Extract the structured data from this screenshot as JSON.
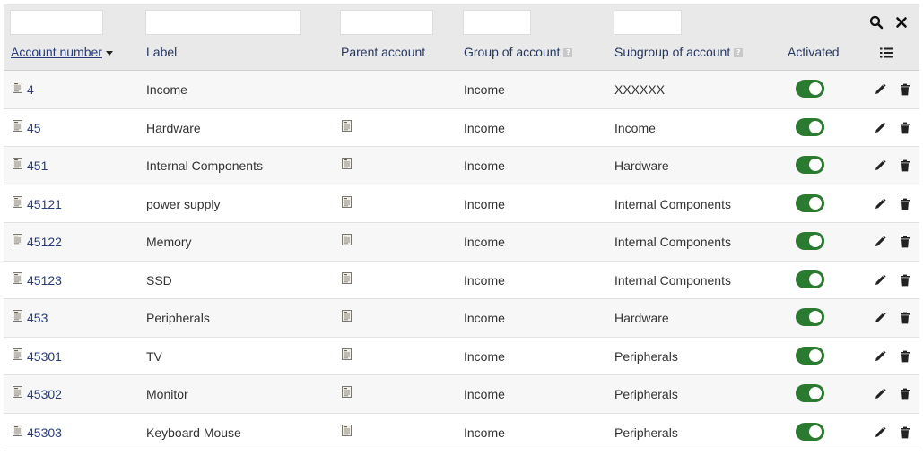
{
  "filters": [
    {
      "col": "account_number",
      "value": ""
    },
    {
      "col": "label",
      "value": ""
    },
    {
      "col": "parent_account",
      "value": ""
    },
    {
      "col": "group_of_account",
      "value": ""
    },
    {
      "col": "subgroup_of_account",
      "value": ""
    }
  ],
  "columns": {
    "account_number": "Account number",
    "label": "Label",
    "parent_account": "Parent account",
    "group_of_account": "Group of account",
    "subgroup_of_account": "Subgroup of account",
    "activated": "Activated"
  },
  "help_glyph": "?",
  "icons": {
    "search": "search-icon",
    "clear": "close-icon",
    "column_selector": "list-icon",
    "edit": "pencil-icon",
    "delete": "trash-icon",
    "account": "document-icon"
  },
  "colors": {
    "header_bg": "#e9e9e9",
    "link": "#263c7c",
    "toggle_on": "#2a7a2f"
  },
  "rows": [
    {
      "account": "4",
      "label": "Income",
      "has_parent": false,
      "group": "Income",
      "subgroup": "XXXXXX",
      "activated": true
    },
    {
      "account": "45",
      "label": "Hardware",
      "has_parent": true,
      "group": "Income",
      "subgroup": "Income",
      "activated": true
    },
    {
      "account": "451",
      "label": "Internal Components",
      "has_parent": true,
      "group": "Income",
      "subgroup": "Hardware",
      "activated": true
    },
    {
      "account": "45121",
      "label": "power supply",
      "has_parent": true,
      "group": "Income",
      "subgroup": "Internal Components",
      "activated": true
    },
    {
      "account": "45122",
      "label": "Memory",
      "has_parent": true,
      "group": "Income",
      "subgroup": "Internal Components",
      "activated": true
    },
    {
      "account": "45123",
      "label": "SSD",
      "has_parent": true,
      "group": "Income",
      "subgroup": "Internal Components",
      "activated": true
    },
    {
      "account": "453",
      "label": "Peripherals",
      "has_parent": true,
      "group": "Income",
      "subgroup": "Hardware",
      "activated": true
    },
    {
      "account": "45301",
      "label": "TV",
      "has_parent": true,
      "group": "Income",
      "subgroup": "Peripherals",
      "activated": true
    },
    {
      "account": "45302",
      "label": "Monitor",
      "has_parent": true,
      "group": "Income",
      "subgroup": "Peripherals",
      "activated": true
    },
    {
      "account": "45303",
      "label": "Keyboard Mouse",
      "has_parent": true,
      "group": "Income",
      "subgroup": "Peripherals",
      "activated": true
    }
  ]
}
